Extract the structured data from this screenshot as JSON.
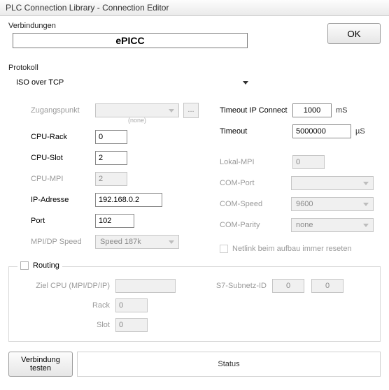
{
  "window": {
    "title": "PLC Connection Library - Connection Editor"
  },
  "labels": {
    "verbindungen": "Verbindungen",
    "protokoll": "Protokoll",
    "zugangspunkt": "Zugangspunkt",
    "none": "(none)",
    "cpu_rack": "CPU-Rack",
    "cpu_slot": "CPU-Slot",
    "cpu_mpi": "CPU-MPI",
    "ip_adresse": "IP-Adresse",
    "port": "Port",
    "mpidp_speed": "MPI/DP Speed",
    "timeout_ip": "Timeout IP Connect",
    "timeout": "Timeout",
    "lokal_mpi": "Lokal-MPI",
    "com_port": "COM-Port",
    "com_speed": "COM-Speed",
    "com_parity": "COM-Parity",
    "netlink_reset": "Netlink beim aufbau immer reseten",
    "routing": "Routing",
    "ziel_cpu": "Ziel CPU (MPI/DP/IP)",
    "rack": "Rack",
    "slot": "Slot",
    "s7_subnetz": "S7-Subnetz-ID",
    "ms": "mS",
    "us": "µS",
    "status": "Status",
    "ellipsis": "..."
  },
  "buttons": {
    "ok": "OK",
    "test": "Verbindung\ntesten"
  },
  "values": {
    "connection_name": "ePICC",
    "protokoll": "ISO over TCP",
    "zugangspunkt": "",
    "cpu_rack": "0",
    "cpu_slot": "2",
    "cpu_mpi": "2",
    "ip_adresse": "192.168.0.2",
    "port": "102",
    "mpidp_speed": "Speed 187k",
    "timeout_ip": "1000",
    "timeout": "5000000",
    "lokal_mpi": "0",
    "com_port": "",
    "com_speed": "9600",
    "com_parity": "none",
    "routing_ziel": "",
    "routing_rack": "0",
    "routing_slot": "0",
    "routing_subnet_a": "0",
    "routing_subnet_b": "0"
  }
}
